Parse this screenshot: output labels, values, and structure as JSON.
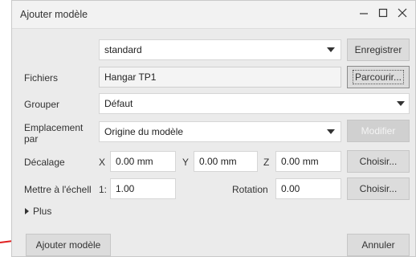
{
  "window": {
    "title": "Ajouter modèle",
    "controls": [
      "minimize-icon",
      "maximize-icon",
      "close-icon"
    ]
  },
  "preset": {
    "selected": "standard",
    "save_label": "Enregistrer"
  },
  "files": {
    "label": "Fichiers",
    "value": "Hangar TP1",
    "browse_label": "Parcourir..."
  },
  "group": {
    "label": "Grouper",
    "selected": "Défaut"
  },
  "location": {
    "label": "Emplacement par",
    "selected": "Origine du modèle",
    "modify_label": "Modifier"
  },
  "offset": {
    "label": "Décalage",
    "x_label": "X",
    "x_value": "0.00 mm",
    "y_label": "Y",
    "y_value": "0.00 mm",
    "z_label": "Z",
    "z_value": "0.00 mm",
    "choose_label": "Choisir..."
  },
  "scale": {
    "label": "Mettre à l'échell",
    "prefix": "1:",
    "value": "1.00",
    "rotation_label": "Rotation",
    "rotation_value": "0.00",
    "choose_label": "Choisir..."
  },
  "more": {
    "label": "Plus"
  },
  "footer": {
    "add_label": "Ajouter modèle",
    "cancel_label": "Annuler"
  },
  "colors": {
    "dialog_bg": "#ebebeb",
    "button_bg": "#dcdcdc",
    "annotation_arrow": "#e02020"
  }
}
